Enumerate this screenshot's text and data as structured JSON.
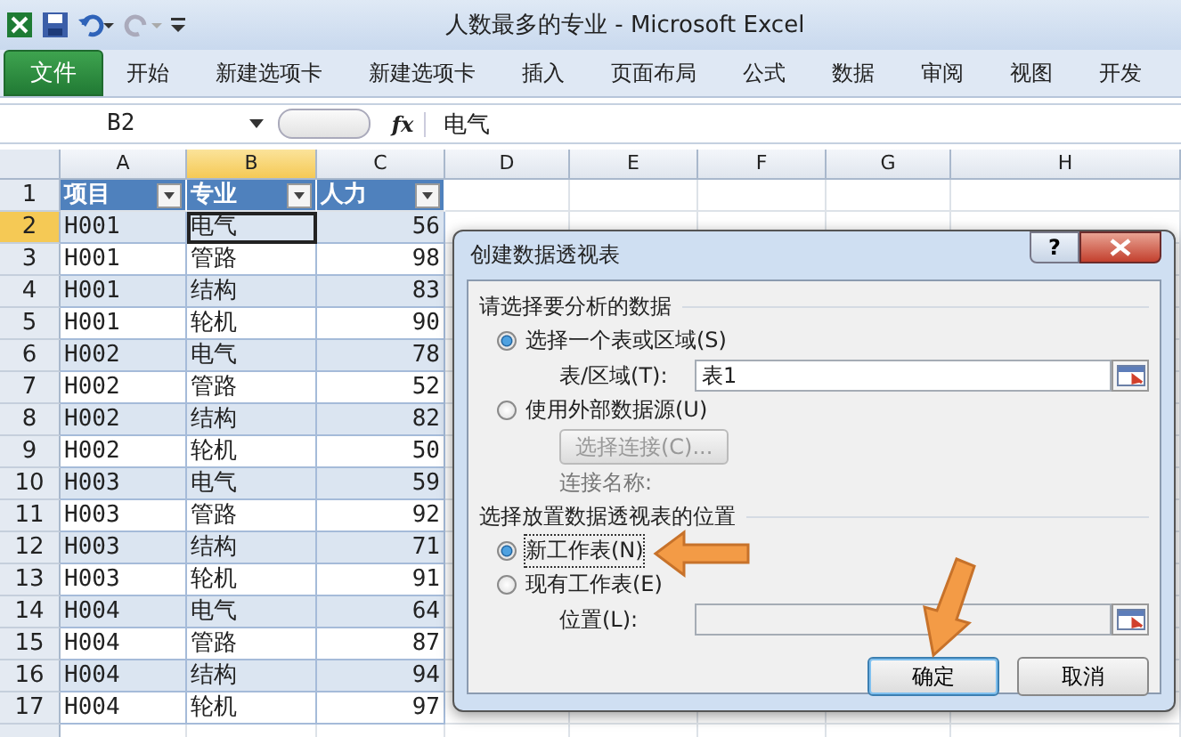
{
  "window": {
    "title": "人数最多的专业  -  Microsoft Excel"
  },
  "ribbon_tabs": [
    {
      "label": "文件",
      "kind": "file"
    },
    {
      "label": "开始",
      "kind": "tab"
    },
    {
      "label": "新建选项卡",
      "kind": "tab"
    },
    {
      "label": "新建选项卡",
      "kind": "tab"
    },
    {
      "label": "插入",
      "kind": "tab"
    },
    {
      "label": "页面布局",
      "kind": "tab"
    },
    {
      "label": "公式",
      "kind": "tab"
    },
    {
      "label": "数据",
      "kind": "tab"
    },
    {
      "label": "审阅",
      "kind": "tab"
    },
    {
      "label": "视图",
      "kind": "tab"
    },
    {
      "label": "开发",
      "kind": "tab"
    }
  ],
  "formula_bar": {
    "name_box": "B2",
    "fx": "fx",
    "value": "电气"
  },
  "columns": [
    {
      "label": "A",
      "selected": false
    },
    {
      "label": "B",
      "selected": true
    },
    {
      "label": "C",
      "selected": false
    },
    {
      "label": "D",
      "selected": false
    },
    {
      "label": "E",
      "selected": false
    },
    {
      "label": "F",
      "selected": false
    },
    {
      "label": "G",
      "selected": false
    },
    {
      "label": "H",
      "selected": false
    }
  ],
  "table_header": {
    "row": "1",
    "cells": [
      "项目",
      "专业",
      "人力"
    ]
  },
  "rows": [
    {
      "row": "2",
      "selected": true,
      "cells": [
        "H001",
        "电气",
        "56"
      ]
    },
    {
      "row": "3",
      "selected": false,
      "cells": [
        "H001",
        "管路",
        "98"
      ]
    },
    {
      "row": "4",
      "selected": false,
      "cells": [
        "H001",
        "结构",
        "83"
      ]
    },
    {
      "row": "5",
      "selected": false,
      "cells": [
        "H001",
        "轮机",
        "90"
      ]
    },
    {
      "row": "6",
      "selected": false,
      "cells": [
        "H002",
        "电气",
        "78"
      ]
    },
    {
      "row": "7",
      "selected": false,
      "cells": [
        "H002",
        "管路",
        "52"
      ]
    },
    {
      "row": "8",
      "selected": false,
      "cells": [
        "H002",
        "结构",
        "82"
      ]
    },
    {
      "row": "9",
      "selected": false,
      "cells": [
        "H002",
        "轮机",
        "50"
      ]
    },
    {
      "row": "10",
      "selected": false,
      "cells": [
        "H003",
        "电气",
        "59"
      ]
    },
    {
      "row": "11",
      "selected": false,
      "cells": [
        "H003",
        "管路",
        "92"
      ]
    },
    {
      "row": "12",
      "selected": false,
      "cells": [
        "H003",
        "结构",
        "71"
      ]
    },
    {
      "row": "13",
      "selected": false,
      "cells": [
        "H003",
        "轮机",
        "91"
      ]
    },
    {
      "row": "14",
      "selected": false,
      "cells": [
        "H004",
        "电气",
        "64"
      ]
    },
    {
      "row": "15",
      "selected": false,
      "cells": [
        "H004",
        "管路",
        "87"
      ]
    },
    {
      "row": "16",
      "selected": false,
      "cells": [
        "H004",
        "结构",
        "94"
      ]
    },
    {
      "row": "17",
      "selected": false,
      "cells": [
        "H004",
        "轮机",
        "97"
      ]
    }
  ],
  "dialog": {
    "title": "创建数据透视表",
    "help": "?",
    "section_1": "请选择要分析的数据",
    "option_table": {
      "label": "选择一个表或区域(S)",
      "checked": true
    },
    "range_label": "表/区域(T):",
    "range_value": "表1",
    "option_external": {
      "label": "使用外部数据源(U)",
      "checked": false
    },
    "connection_button": {
      "label": "选择连接(C)...",
      "disabled": true
    },
    "connection_name": "连接名称:",
    "section_2": "选择放置数据透视表的位置",
    "option_new": {
      "label": "新工作表(N)",
      "checked": true
    },
    "option_existing": {
      "label": "现有工作表(E)",
      "checked": false
    },
    "location_label": "位置(L):",
    "buttons": [
      "确定",
      "取消"
    ]
  }
}
